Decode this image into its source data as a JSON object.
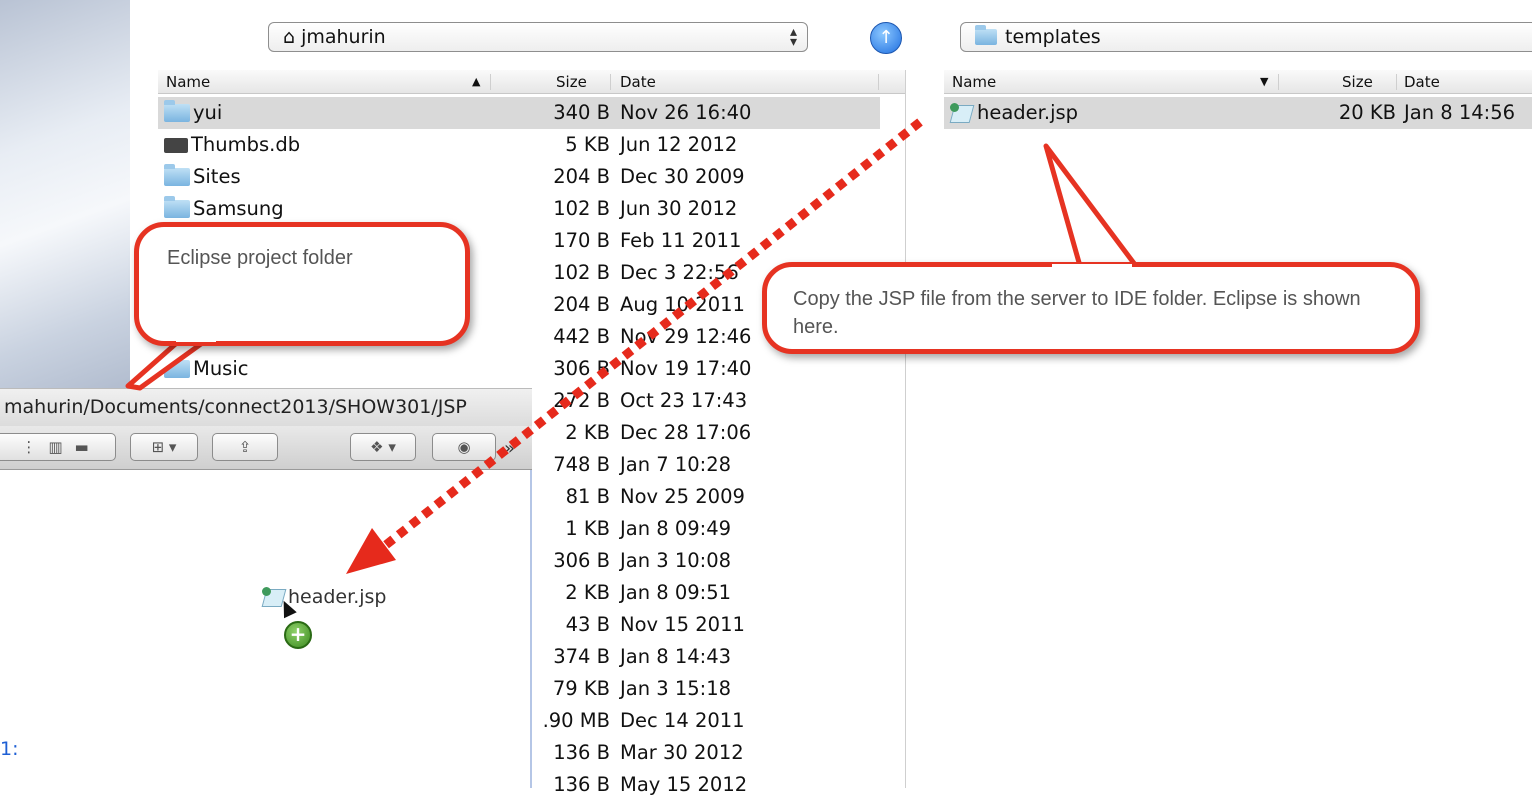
{
  "left_pane": {
    "location": "jmahurin",
    "columns": {
      "name": "Name",
      "size": "Size",
      "date": "Date"
    },
    "rows": [
      {
        "name": "yui",
        "icon": "folder-icon",
        "size": "340 B",
        "date": "Nov 26 16:40"
      },
      {
        "name": "Thumbs.db",
        "icon": "database-file-icon",
        "size": "5 KB",
        "date": "Jun 12 2012"
      },
      {
        "name": "Sites",
        "icon": "sites-folder-icon",
        "size": "204 B",
        "date": "Dec 30 2009"
      },
      {
        "name": "Samsung",
        "icon": "folder-icon",
        "size": "102 B",
        "date": "Jun 30 2012"
      },
      {
        "name": "",
        "icon": "",
        "size": "170 B",
        "date": "Feb 11 2011"
      },
      {
        "name": "",
        "icon": "",
        "size": "102 B",
        "date": "Dec 3 22:56"
      },
      {
        "name": "",
        "icon": "",
        "size": "204 B",
        "date": "Aug 10 2011"
      },
      {
        "name": "",
        "icon": "",
        "size": "442 B",
        "date": "Nov 29 12:46"
      },
      {
        "name": "Music",
        "icon": "folder-icon",
        "size": "306 B",
        "date": "Nov 19 17:40"
      },
      {
        "name": "",
        "icon": "",
        "size": "272 B",
        "date": "Oct 23 17:43"
      },
      {
        "name": "",
        "icon": "",
        "size": "2 KB",
        "date": "Dec 28 17:06"
      },
      {
        "name": "",
        "icon": "",
        "size": "748 B",
        "date": "Jan 7 10:28"
      },
      {
        "name": "",
        "icon": "",
        "size": "81 B",
        "date": "Nov 25 2009"
      },
      {
        "name": "",
        "icon": "",
        "size": "1 KB",
        "date": "Jan 8 09:49"
      },
      {
        "name": "",
        "icon": "",
        "size": "306 B",
        "date": "Jan 3 10:08"
      },
      {
        "name": "",
        "icon": "",
        "size": "2 KB",
        "date": "Jan 8 09:51"
      },
      {
        "name": "",
        "icon": "",
        "size": "43 B",
        "date": "Nov 15 2011"
      },
      {
        "name": "",
        "icon": "",
        "size": "374 B",
        "date": "Jan 8 14:43"
      },
      {
        "name": "",
        "icon": "",
        "size": "79 KB",
        "date": "Jan 3 15:18"
      },
      {
        "name": "",
        "icon": "",
        "size": ".90 MB",
        "date": "Dec 14 2011"
      },
      {
        "name": "",
        "icon": "",
        "size": "136 B",
        "date": "Mar 30 2012"
      },
      {
        "name": "",
        "icon": "",
        "size": "136 B",
        "date": "May 15 2012"
      }
    ]
  },
  "right_pane": {
    "location": "templates",
    "columns": {
      "name": "Name",
      "size": "Size",
      "date": "Date"
    },
    "rows": [
      {
        "name": "header.jsp",
        "icon": "jsp-file-icon",
        "size": "20 KB",
        "date": "Jan 8 14:56"
      }
    ]
  },
  "finder_window": {
    "path": "mahurin/Documents/connect2013/SHOW301/JSP",
    "dragged_file": "header.jsp"
  },
  "callouts": {
    "eclipse": "Eclipse project folder",
    "copy": "Copy the JSP file from the server to IDE folder. Eclipse is shown here."
  },
  "edge_fragment": "1:",
  "colors": {
    "callout_red": "#e63322",
    "arrow_red": "#e62a1c",
    "selection_gray": "#d9d9d9"
  }
}
